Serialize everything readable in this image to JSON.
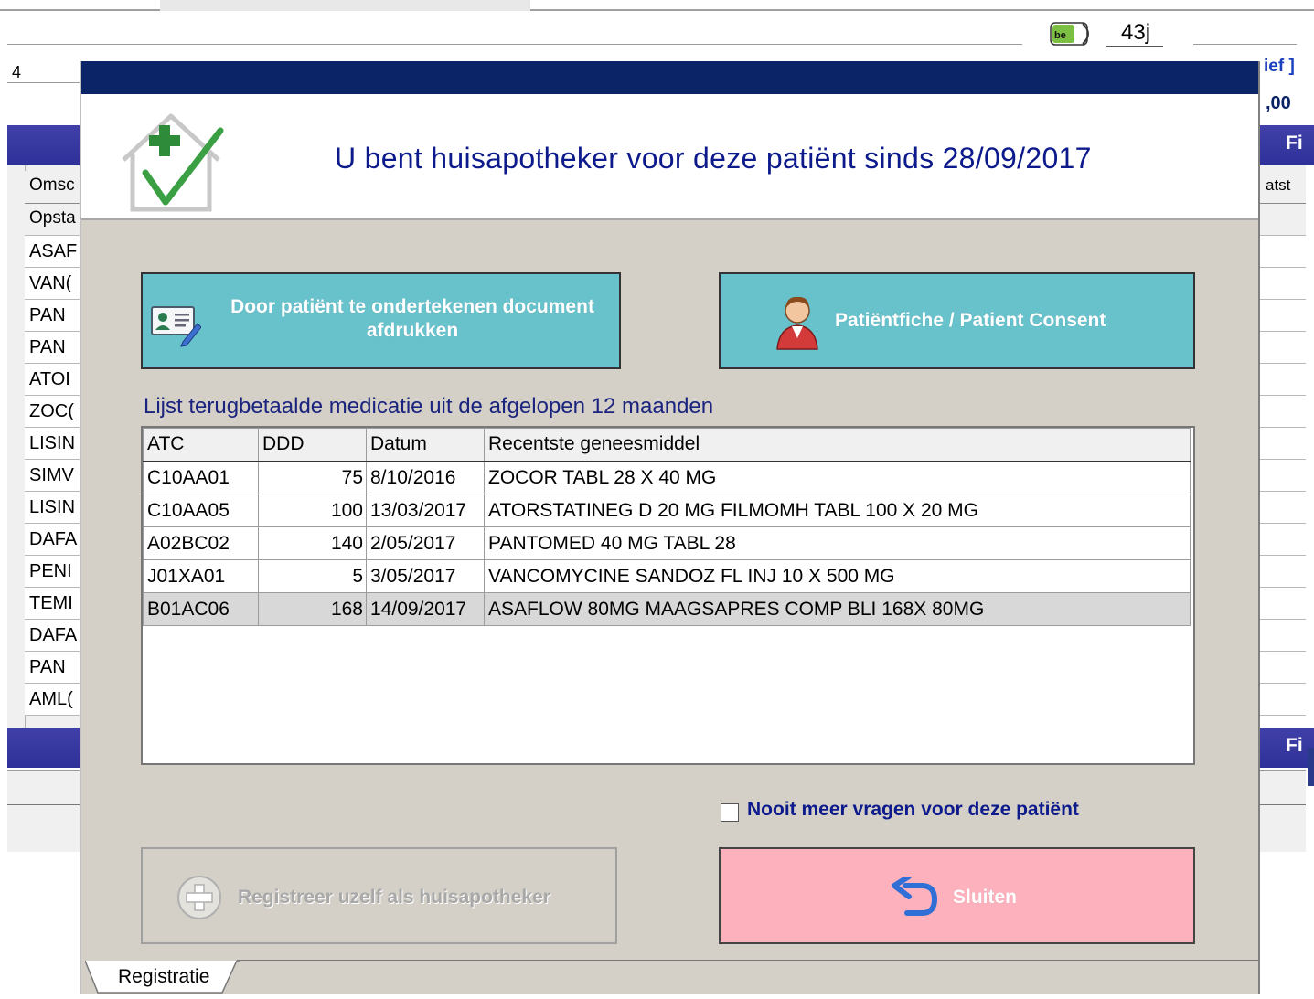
{
  "background": {
    "badge_label": "be",
    "age_text": "43j",
    "left_number": "4",
    "right_texts": [
      "ief ]",
      ",00",
      "Fi",
      "atst",
      "Fi"
    ],
    "column_headers": [
      "Omsc",
      "Opsta"
    ],
    "rows": [
      "ASAF",
      "VAN(",
      "PAN",
      "PAN",
      "ATOI",
      "ZOC(",
      "LISIN",
      "SIMV",
      "LISIN",
      "DAFA",
      "PENI",
      "TEMI",
      "DAFA",
      "PAN",
      "AML("
    ]
  },
  "dialog": {
    "title": "U bent huisapotheker voor deze patiënt sinds 28/09/2017",
    "buttons": {
      "print_document": "Door patiënt te ondertekenen document afdrukken",
      "patient_consent": "Patiëntfiche / Patient Consent",
      "register": "Registreer uzelf als huisapotheker",
      "close": "Sluiten"
    },
    "list_label": "Lijst terugbetaalde medicatie uit de afgelopen 12 maanden",
    "table": {
      "columns": [
        "ATC",
        "DDD",
        "Datum",
        "Recentste geneesmiddel"
      ],
      "rows": [
        {
          "atc": "C10AA01",
          "ddd": "75",
          "datum": "8/10/2016",
          "name": "ZOCOR TABL  28 X 40 MG"
        },
        {
          "atc": "C10AA05",
          "ddd": "100",
          "datum": "13/03/2017",
          "name": "ATORSTATINEG D 20 MG FILMOMH TABL 100 X 20 MG"
        },
        {
          "atc": "A02BC02",
          "ddd": "140",
          "datum": "2/05/2017",
          "name": "PANTOMED  40 MG TABL  28"
        },
        {
          "atc": "J01XA01",
          "ddd": "5",
          "datum": "3/05/2017",
          "name": "VANCOMYCINE SANDOZ FL INJ 10 X  500 MG"
        },
        {
          "atc": "B01AC06",
          "ddd": "168",
          "datum": "14/09/2017",
          "name": "ASAFLOW  80MG MAAGSAPRES COMP BLI 168X 80MG"
        }
      ]
    },
    "checkbox_label": "Nooit meer vragen voor deze patiënt",
    "tab_label": "Registratie"
  },
  "colors": {
    "titlebar": "#0a2467",
    "teal_button": "#68c2cc",
    "pink_button": "#fdb1bd",
    "title_text": "#0d1a8c"
  }
}
